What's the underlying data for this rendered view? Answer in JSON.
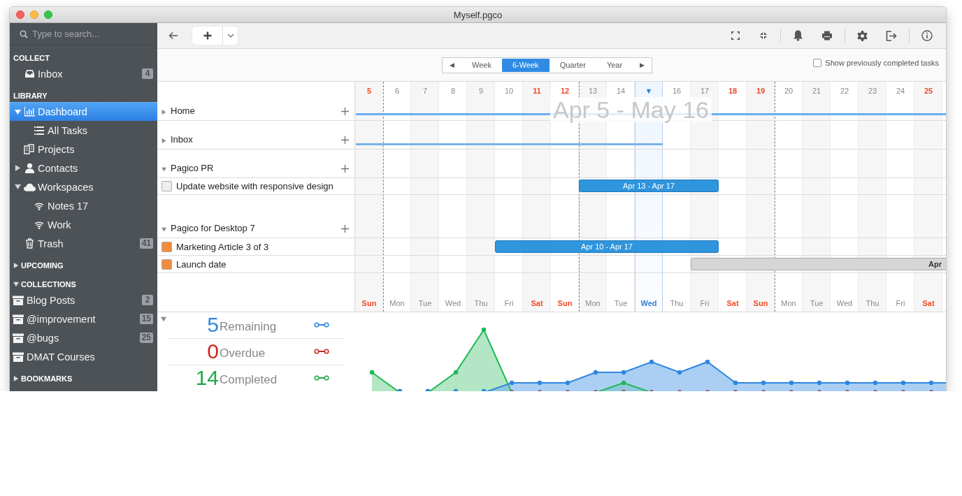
{
  "window": {
    "title": "Myself.pgco"
  },
  "sidebar": {
    "search": {
      "placeholder": "Type to search..."
    },
    "sections": [
      {
        "title": "COLLECT",
        "kind": "label",
        "items": [
          {
            "label": "Inbox",
            "kind": "inbox",
            "count": "4",
            "selected": false
          }
        ]
      },
      {
        "title": "LIBRARY",
        "kind": "label",
        "items": [
          {
            "label": "Dashboard",
            "kind": "dashboard",
            "selected": true,
            "expanded": true,
            "children": [
              {
                "label": "All Tasks",
                "kind": "list",
                "selected": false
              }
            ]
          },
          {
            "label": "Projects",
            "kind": "projects",
            "selected": false
          },
          {
            "label": "Contacts",
            "kind": "contacts",
            "selected": false,
            "expanded": false
          },
          {
            "label": "Workspaces",
            "kind": "cloud",
            "selected": false,
            "expanded": true,
            "children": [
              {
                "label": "Notes 17",
                "kind": "wifi",
                "selected": false
              },
              {
                "label": "Work",
                "kind": "wifi",
                "selected": false
              }
            ]
          },
          {
            "label": "Trash",
            "kind": "trash",
            "count": "41",
            "selected": false
          }
        ]
      },
      {
        "title": "UPCOMING",
        "kind": "toggle",
        "expanded": false
      },
      {
        "title": "COLLECTIONS",
        "kind": "toggle",
        "expanded": true,
        "items": [
          {
            "label": "Blog Posts",
            "kind": "archive",
            "count": "2",
            "selected": false
          },
          {
            "label": "@improvement",
            "kind": "archive",
            "count": "15",
            "selected": false
          },
          {
            "label": "@bugs",
            "kind": "archive",
            "count": "25",
            "selected": false
          },
          {
            "label": "DMAT Courses",
            "kind": "archive",
            "selected": false
          }
        ]
      },
      {
        "title": "BOOKMARKS",
        "kind": "toggle",
        "expanded": false
      }
    ]
  },
  "view_switcher": {
    "prev": "◀",
    "options": [
      {
        "label": "Week",
        "selected": false
      },
      {
        "label": "6-Week",
        "selected": true
      },
      {
        "label": "Quarter",
        "selected": false
      },
      {
        "label": "Year",
        "selected": false
      }
    ],
    "next": "▶"
  },
  "completed_toggle": {
    "label": "Show previously completed tasks",
    "checked": false
  },
  "timeline": {
    "range": "Apr 5 - May 16",
    "days": [
      {
        "date": "5",
        "weekday": "Sun",
        "weekend": true,
        "today": false
      },
      {
        "date": "6",
        "weekday": "Mon",
        "weekend": false,
        "today": false
      },
      {
        "date": "7",
        "weekday": "Tue",
        "weekend": false,
        "today": false
      },
      {
        "date": "8",
        "weekday": "Wed",
        "weekend": false,
        "today": false
      },
      {
        "date": "9",
        "weekday": "Thu",
        "weekend": false,
        "today": false
      },
      {
        "date": "10",
        "weekday": "Fri",
        "weekend": false,
        "today": false
      },
      {
        "date": "11",
        "weekday": "Sat",
        "weekend": true,
        "today": false
      },
      {
        "date": "12",
        "weekday": "Sun",
        "weekend": true,
        "today": false
      },
      {
        "date": "13",
        "weekday": "Mon",
        "weekend": false,
        "today": false
      },
      {
        "date": "14",
        "weekday": "Tue",
        "weekend": false,
        "today": false
      },
      {
        "date": "▼",
        "weekday": "Wed",
        "weekend": false,
        "today": true
      },
      {
        "date": "16",
        "weekday": "Thu",
        "weekend": false,
        "today": false
      },
      {
        "date": "17",
        "weekday": "Fri",
        "weekend": false,
        "today": false
      },
      {
        "date": "18",
        "weekday": "Sat",
        "weekend": true,
        "today": false
      },
      {
        "date": "19",
        "weekday": "Sun",
        "weekend": true,
        "today": false
      },
      {
        "date": "20",
        "weekday": "Mon",
        "weekend": false,
        "today": false
      },
      {
        "date": "21",
        "weekday": "Tue",
        "weekend": false,
        "today": false
      },
      {
        "date": "22",
        "weekday": "Wed",
        "weekend": false,
        "today": false
      },
      {
        "date": "23",
        "weekday": "Thu",
        "weekend": false,
        "today": false
      },
      {
        "date": "24",
        "weekday": "Fri",
        "weekend": false,
        "today": false
      },
      {
        "date": "25",
        "weekday": "Sat",
        "weekend": true,
        "today": false
      }
    ]
  },
  "groups": [
    {
      "name": "Home",
      "expanded": false
    },
    {
      "name": "Inbox",
      "expanded": false
    },
    {
      "name": "Pagico PR",
      "expanded": true,
      "tasks": [
        {
          "name": "Update website with responsive design",
          "color": "#eeeeee",
          "bar": {
            "label": "Apr 13 - Apr 17",
            "color": "#2f95dc"
          }
        }
      ]
    },
    {
      "name": "Pagico for Desktop 7",
      "expanded": true,
      "tasks": [
        {
          "name": "Marketing Article 3 of 3",
          "color": "#f28c3c",
          "bar": {
            "label": "Apr 10 - Apr 17",
            "color": "#2f95dc"
          }
        },
        {
          "name": "Launch date",
          "color": "#f28c3c",
          "bar": {
            "label": "Apr",
            "color": "#d6d6d6"
          }
        }
      ]
    }
  ],
  "stats": {
    "expanded": true,
    "items": [
      {
        "value": "5",
        "label": "Remaining",
        "color": "#2f86e0"
      },
      {
        "value": "0",
        "label": "Overdue",
        "color": "#c8281e"
      },
      {
        "value": "14",
        "label": "Completed",
        "color": "#20a847"
      }
    ]
  }
}
